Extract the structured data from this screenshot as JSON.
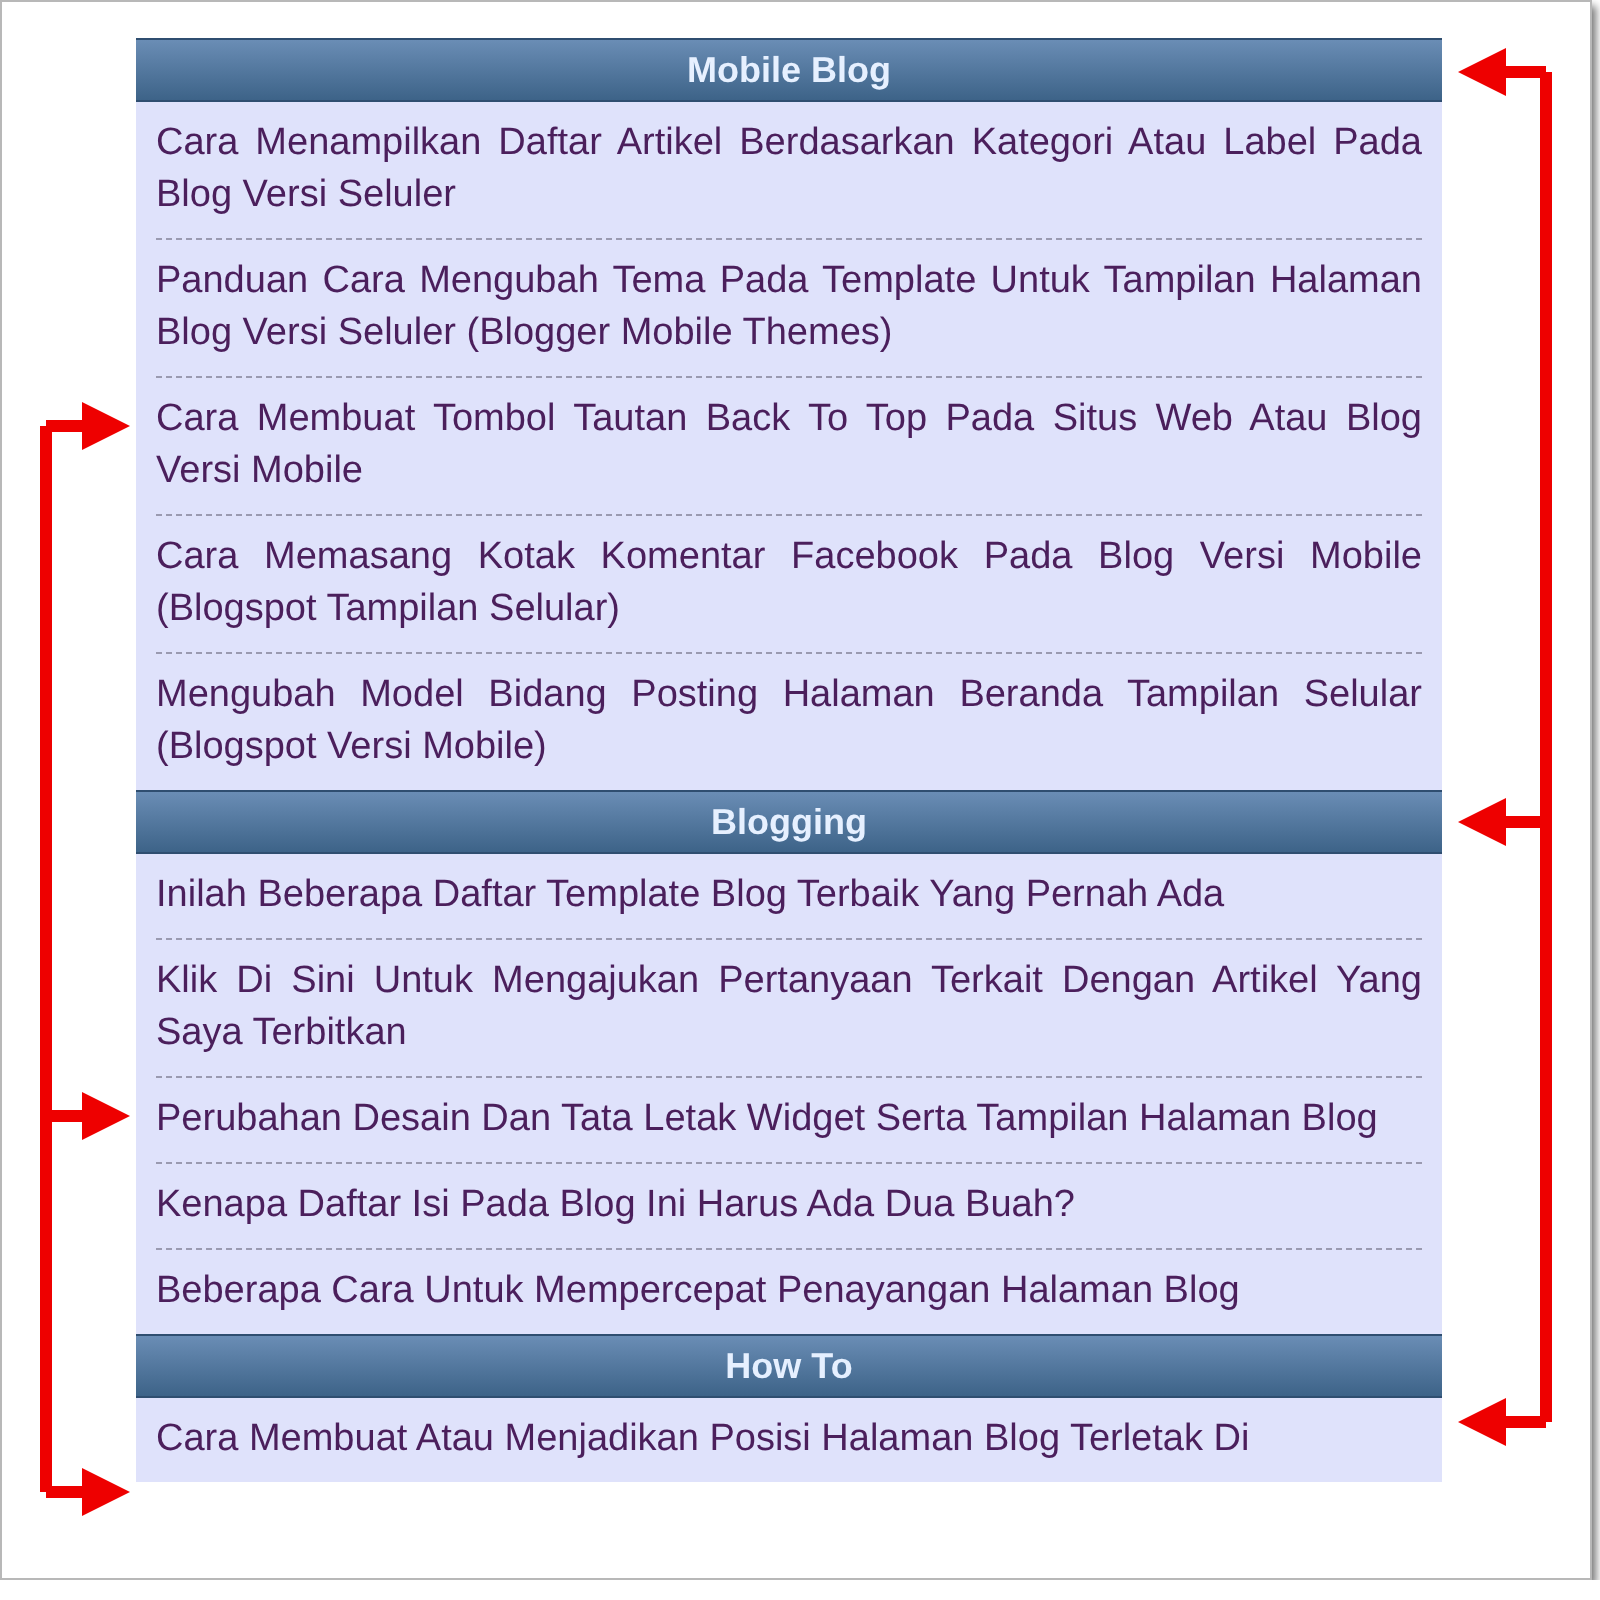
{
  "sections": [
    {
      "title": "Mobile Blog",
      "items": [
        "Cara Menampilkan Daftar Artikel Berdasarkan Kategori Atau Label Pada Blog Versi Seluler",
        "Panduan Cara Mengubah Tema Pada Template Untuk Tampilan Halaman Blog Versi Seluler (Blogger Mobile Themes)",
        "Cara Membuat Tombol Tautan Back To Top Pada Situs Web Atau Blog Versi Mobile",
        "Cara Memasang Kotak Komentar Facebook Pada Blog Versi Mobile (Blogspot Tampilan Selular)",
        "Mengubah Model Bidang Posting Halaman Beranda Tampilan Selular (Blogspot Versi Mobile)"
      ]
    },
    {
      "title": "Blogging",
      "items": [
        "Inilah Beberapa Daftar Template Blog Terbaik Yang Pernah Ada",
        "Klik Di Sini Untuk Mengajukan Pertanyaan Terkait Dengan Artikel Yang Saya Terbitkan",
        "Perubahan Desain Dan Tata Letak Widget Serta Tampilan Halaman Blog",
        "Kenapa Daftar Isi Pada Blog Ini Harus Ada Dua Buah?",
        "Beberapa Cara Untuk Mempercepat Penayangan Halaman Blog"
      ]
    },
    {
      "title": "How To",
      "items": [
        "Cara Membuat Atau Menjadikan Posisi Halaman Blog Terletak Di"
      ]
    }
  ]
}
